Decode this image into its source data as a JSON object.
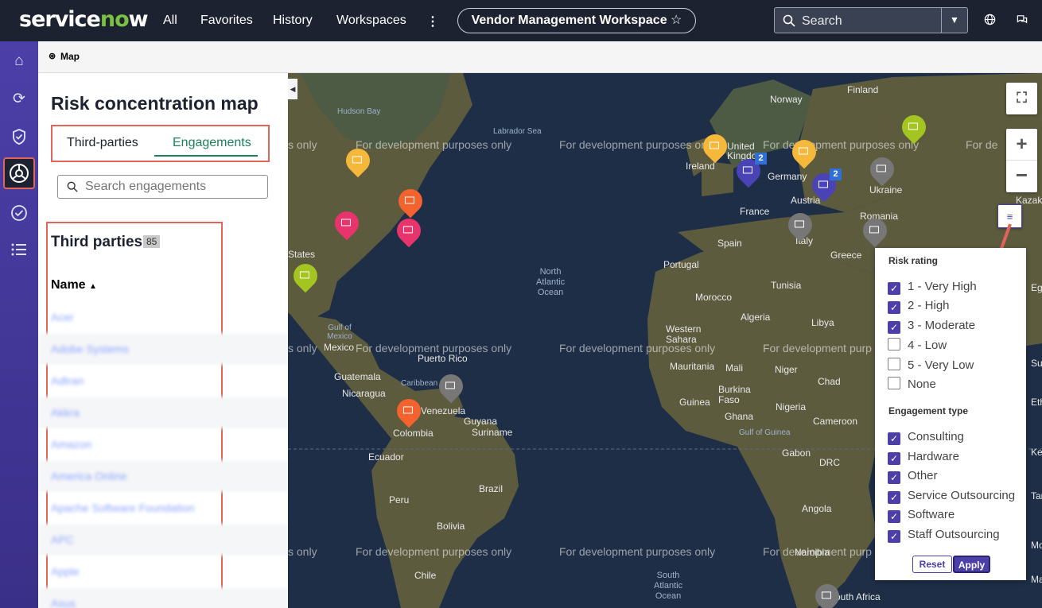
{
  "topbar": {
    "brand": "servicenow",
    "nav": [
      "All",
      "Favorites",
      "History",
      "Workspaces"
    ],
    "more": "⋮",
    "workspace": "Vendor Management Workspace",
    "search_label": "Search"
  },
  "breadcrumb": "Map",
  "left": {
    "title": "Risk concentration map",
    "tabs": [
      "Third-parties",
      "Engagements"
    ],
    "search_placeholder": "Search engagements",
    "list_title": "Third parties",
    "count": "85",
    "column": "Name",
    "rows": [
      "Acer",
      "Adobe Systems",
      "Adtran",
      "Akkra",
      "Amazon",
      "America Online",
      "Apache Software Foundation",
      "APC",
      "Apple",
      "Asus"
    ]
  },
  "map": {
    "watermark": "For development purposes only",
    "labels": [
      "Hudson Bay",
      "Labrador Sea",
      "Finland",
      "Norway",
      "Ireland",
      "United Kingdom",
      "Germany",
      "Austria",
      "Ukraine",
      "Kazakh",
      "France",
      "Romania",
      "Spain",
      "Italy",
      "Greece",
      "Portugal",
      "Tunisia",
      "Morocco",
      "Algeria",
      "Libya",
      "Western Sahara",
      "Mauritania",
      "Mali",
      "Niger",
      "Chad",
      "Burkina Faso",
      "Nigeria",
      "Ghana",
      "Guinea",
      "Cameroon",
      "Gabon",
      "DRC",
      "Angola",
      "Namibia",
      "South Africa",
      "States",
      "Gulf of Mexico",
      "Mexico",
      "Guatemala",
      "Nicaragua",
      "Puerto Rico",
      "Caribbean Sea",
      "Venezuela",
      "Colombia",
      "Guyana",
      "Suriname",
      "Ecuador",
      "Peru",
      "Brazil",
      "Bolivia",
      "Chile",
      "Gulf of Guinea",
      "Egyp",
      "Sudan",
      "Ethio",
      "Tanza",
      "Mozam",
      "Mada",
      "Ken"
    ],
    "oceans": [
      "North\nAtlantic\nOcean",
      "South\nAtlantic\nOcean"
    ],
    "badges": [
      "2",
      "2"
    ]
  },
  "filter": {
    "risk_title": "Risk rating",
    "risk": [
      {
        "label": "1 - Very High",
        "checked": true
      },
      {
        "label": "2 - High",
        "checked": true
      },
      {
        "label": "3 - Moderate",
        "checked": true
      },
      {
        "label": "4 - Low",
        "checked": false
      },
      {
        "label": "5 - Very Low",
        "checked": false
      },
      {
        "label": "None",
        "checked": false
      }
    ],
    "type_title": "Engagement type",
    "types": [
      {
        "label": "Consulting",
        "checked": true
      },
      {
        "label": "Hardware",
        "checked": true
      },
      {
        "label": "Other",
        "checked": true
      },
      {
        "label": "Service Outsourcing",
        "checked": true
      },
      {
        "label": "Software",
        "checked": true
      },
      {
        "label": "Staff Outsourcing",
        "checked": true
      }
    ],
    "reset": "Reset",
    "apply": "Apply"
  },
  "colors": {
    "rail": "#4c3fa8",
    "topbar": "#1d2230",
    "accent": "#1a7f5a",
    "highlight": "#e2645a",
    "very_high": "#e8336d",
    "high": "#f4622e",
    "moderate": "#f6b83a",
    "low": "#a4c520",
    "none": "#777777",
    "multi": "#4a43b6"
  }
}
